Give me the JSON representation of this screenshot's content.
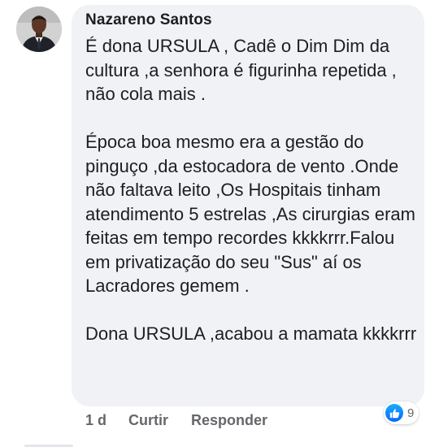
{
  "comment": {
    "author": "Nazareno Santos",
    "text": "É dona URSULA , Cadê o Dim Dim da cultura ,a senhora é figurinha repetida , não cola mais .\n\nÉpoca boa mesmo era a gestão do pinguço ,da estocadora de vento .Onde não faltava leito ,Os Hospitais tinham atendimento 5 estrelas ,As cirurgias eram feitas em tempo recordes kkkkrrr.Falou em privatização do seu \"Sus\" aí os Lacradores gemem .\n\nDona URSULA ,acabou a mamata kkkkrrr",
    "timestamp": "1 d",
    "like_label": "Curtir",
    "reply_label": "Responder",
    "reaction_count": "9",
    "reaction_icon": "like-thumb-icon"
  },
  "colors": {
    "bubble": "#f0f2f5",
    "text": "#1c1e21",
    "secondary": "#65676b",
    "like_blue": "#0866ff"
  }
}
